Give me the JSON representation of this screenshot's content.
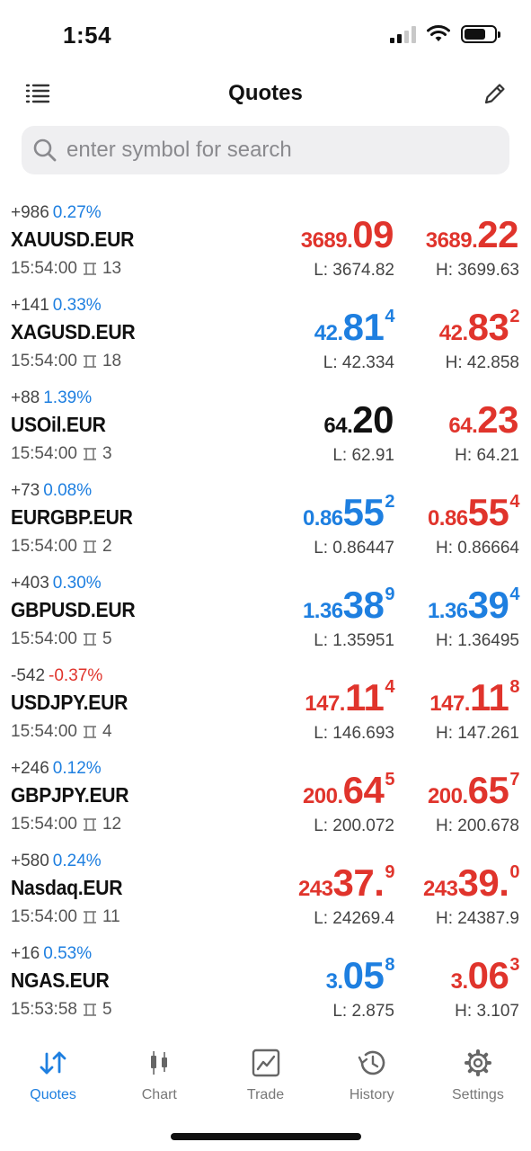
{
  "status": {
    "time": "1:54"
  },
  "nav": {
    "title": "Quotes"
  },
  "search": {
    "placeholder": "enter symbol for search"
  },
  "colors": {
    "accent_blue": "#1e7fe0",
    "price_red": "#e0342c",
    "text_dark": "#111111"
  },
  "quotes": [
    {
      "change": "+986",
      "pct": "0.27%",
      "symbol": "XAUUSD.EUR",
      "time": "15:54:00",
      "spread": "13",
      "bid": {
        "big": "3689.",
        "main": "09",
        "sup": "",
        "color": "red"
      },
      "ask": {
        "big": "3689.",
        "main": "22",
        "sup": "",
        "color": "red"
      },
      "low": "L: 3674.82",
      "high": "H: 3699.63"
    },
    {
      "change": "+141",
      "pct": "0.33%",
      "symbol": "XAGUSD.EUR",
      "time": "15:54:00",
      "spread": "18",
      "bid": {
        "big": "42.",
        "main": "81",
        "sup": "4",
        "color": "blue"
      },
      "ask": {
        "big": "42.",
        "main": "83",
        "sup": "2",
        "color": "red"
      },
      "low": "L: 42.334",
      "high": "H: 42.858"
    },
    {
      "change": "+88",
      "pct": "1.39%",
      "symbol": "USOil.EUR",
      "time": "15:54:00",
      "spread": "3",
      "bid": {
        "big": "64.",
        "main": "20",
        "sup": "",
        "color": "black"
      },
      "ask": {
        "big": "64.",
        "main": "23",
        "sup": "",
        "color": "red"
      },
      "low": "L: 62.91",
      "high": "H: 64.21"
    },
    {
      "change": "+73",
      "pct": "0.08%",
      "symbol": "EURGBP.EUR",
      "time": "15:54:00",
      "spread": "2",
      "bid": {
        "big": "0.86",
        "main": "55",
        "sup": "2",
        "color": "blue"
      },
      "ask": {
        "big": "0.86",
        "main": "55",
        "sup": "4",
        "color": "red"
      },
      "low": "L: 0.86447",
      "high": "H: 0.86664"
    },
    {
      "change": "+403",
      "pct": "0.30%",
      "symbol": "GBPUSD.EUR",
      "time": "15:54:00",
      "spread": "5",
      "bid": {
        "big": "1.36",
        "main": "38",
        "sup": "9",
        "color": "blue"
      },
      "ask": {
        "big": "1.36",
        "main": "39",
        "sup": "4",
        "color": "blue"
      },
      "low": "L: 1.35951",
      "high": "H: 1.36495"
    },
    {
      "change": "-542",
      "pct": "-0.37%",
      "pct_negative": true,
      "symbol": "USDJPY.EUR",
      "time": "15:54:00",
      "spread": "4",
      "bid": {
        "big": "147.",
        "main": "11",
        "sup": "4",
        "color": "red"
      },
      "ask": {
        "big": "147.",
        "main": "11",
        "sup": "8",
        "color": "red"
      },
      "low": "L: 146.693",
      "high": "H: 147.261"
    },
    {
      "change": "+246",
      "pct": "0.12%",
      "symbol": "GBPJPY.EUR",
      "time": "15:54:00",
      "spread": "12",
      "bid": {
        "big": "200.",
        "main": "64",
        "sup": "5",
        "color": "red"
      },
      "ask": {
        "big": "200.",
        "main": "65",
        "sup": "7",
        "color": "red"
      },
      "low": "L: 200.072",
      "high": "H: 200.678"
    },
    {
      "change": "+580",
      "pct": "0.24%",
      "symbol": "Nasdaq.EUR",
      "time": "15:54:00",
      "spread": "11",
      "bid": {
        "big": "243",
        "main": "37.",
        "sup": "9",
        "color": "red"
      },
      "ask": {
        "big": "243",
        "main": "39.",
        "sup": "0",
        "color": "red"
      },
      "low": "L: 24269.4",
      "high": "H: 24387.9"
    },
    {
      "change": "+16",
      "pct": "0.53%",
      "symbol": "NGAS.EUR",
      "time": "15:53:58",
      "spread": "5",
      "bid": {
        "big": "3.",
        "main": "05",
        "sup": "8",
        "color": "blue"
      },
      "ask": {
        "big": "3.",
        "main": "06",
        "sup": "3",
        "color": "red"
      },
      "low": "L: 2.875",
      "high": "H: 3.107"
    }
  ],
  "tabs": [
    {
      "label": "Quotes",
      "icon": "quotes-arrows-icon",
      "active": true
    },
    {
      "label": "Chart",
      "icon": "candlestick-icon",
      "active": false
    },
    {
      "label": "Trade",
      "icon": "trade-chart-icon",
      "active": false
    },
    {
      "label": "History",
      "icon": "history-clock-icon",
      "active": false
    },
    {
      "label": "Settings",
      "icon": "gear-icon",
      "active": false
    }
  ]
}
